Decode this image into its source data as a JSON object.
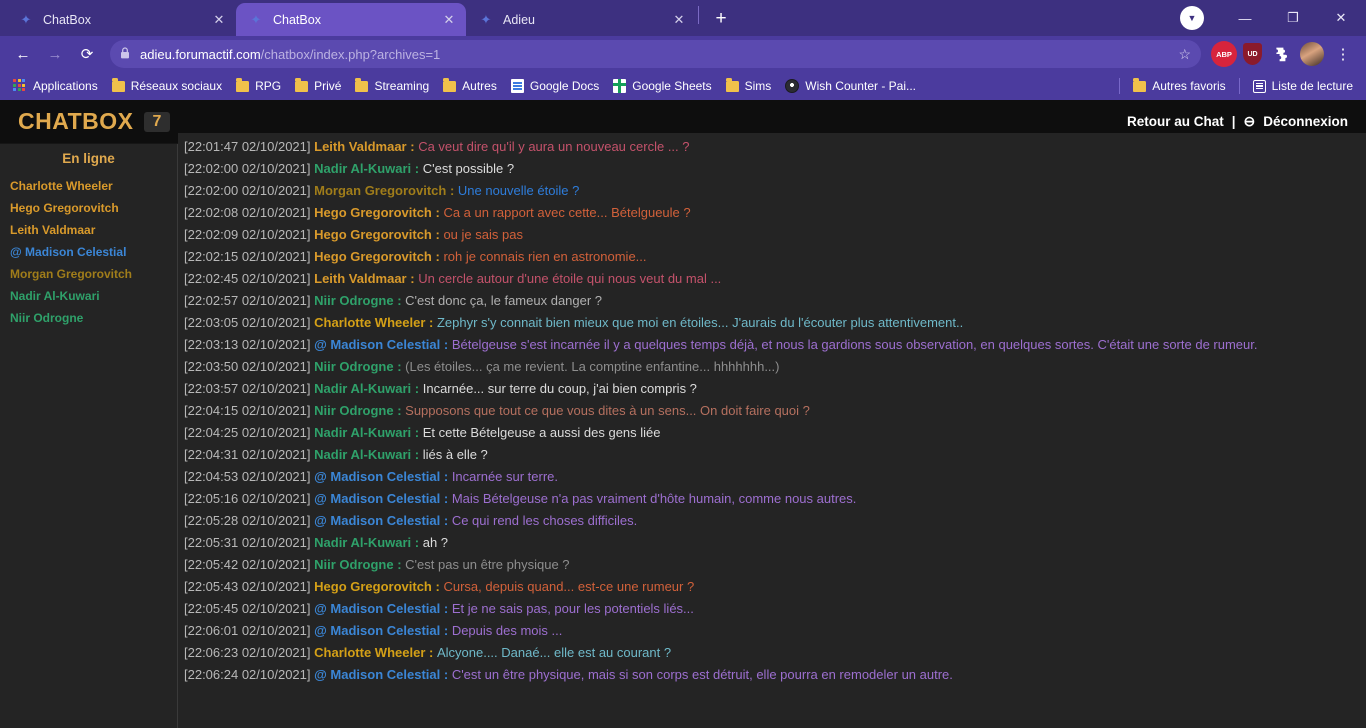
{
  "browser": {
    "tabs": [
      {
        "title": "ChatBox",
        "active": false,
        "favicon": "star-favicon"
      },
      {
        "title": "ChatBox",
        "active": true,
        "favicon": "star-favicon"
      },
      {
        "title": "Adieu",
        "active": false,
        "favicon": "star-favicon"
      }
    ],
    "new_tab_label": "+",
    "close_label": "✕",
    "window_controls": {
      "minimize": "—",
      "maximize": "❐",
      "close": "✕"
    },
    "profile_badge": "▼",
    "nav": {
      "back": "←",
      "forward": "→",
      "reload": "⟳"
    },
    "omnibox": {
      "lock": "🔒",
      "url_domain": "adieu.forumactif.com",
      "url_path": "/chatbox/index.php?archives=1",
      "star": "☆"
    },
    "extensions": [
      {
        "name": "adblock-plus-extension",
        "label": "ABP"
      },
      {
        "name": "ublock-extension",
        "label": "UD"
      },
      {
        "name": "puzzle-extension",
        "label": "❖"
      }
    ],
    "menu_label": "⋮",
    "bookmarks": [
      {
        "label": "Applications",
        "icon": "apps-grid-icon"
      },
      {
        "label": "Réseaux sociaux",
        "icon": "folder-icon"
      },
      {
        "label": "RPG",
        "icon": "folder-icon"
      },
      {
        "label": "Privé",
        "icon": "folder-icon"
      },
      {
        "label": "Streaming",
        "icon": "folder-icon"
      },
      {
        "label": "Autres",
        "icon": "folder-icon"
      },
      {
        "label": "Google Docs",
        "icon": "google-docs-icon"
      },
      {
        "label": "Google Sheets",
        "icon": "google-sheets-icon"
      },
      {
        "label": "Sims",
        "icon": "folder-icon"
      },
      {
        "label": "Wish Counter - Pai...",
        "icon": "wish-counter-icon"
      }
    ],
    "bookmarks_right": [
      {
        "label": "Autres favoris",
        "icon": "folder-icon"
      },
      {
        "label": "Liste de lecture",
        "icon": "reading-list-icon"
      }
    ]
  },
  "chatbox": {
    "title": "CHATBOX",
    "badge": "7",
    "back_to_chat": "Retour au Chat",
    "separator": "|",
    "logout_icon": "⊖",
    "logout": "Déconnexion",
    "online_title": "En ligne",
    "online_users": [
      {
        "name": "Charlotte Wheeler",
        "color": "#d99a2b"
      },
      {
        "name": "Hego Gregorovitch",
        "color": "#d99a2b"
      },
      {
        "name": "Leith Valdmaar",
        "color": "#d99a2b"
      },
      {
        "name": "@ Madison Celestial",
        "color": "#3b86d6"
      },
      {
        "name": "Morgan Gregorovitch",
        "color": "#a07d1a"
      },
      {
        "name": "Nadir Al-Kuwari",
        "color": "#2fa16a"
      },
      {
        "name": "Niir Odrogne",
        "color": "#2fa16a"
      }
    ],
    "messages": [
      {
        "time": "[22:01:47 02/10/2021]",
        "author": "Leith Valdmaar",
        "author_color": "#d99a2b",
        "text": "Ca veut dire qu'il y aura un nouveau cercle ... ?",
        "text_color": "#c4526b"
      },
      {
        "time": "[22:02:00 02/10/2021]",
        "author": "Nadir Al-Kuwari",
        "author_color": "#2fa16a",
        "text": "C'est possible ?",
        "text_color": "#dcdcdc"
      },
      {
        "time": "[22:02:00 02/10/2021]",
        "author": "Morgan Gregorovitch",
        "author_color": "#a07d1a",
        "text": "Une nouvelle étoile ?",
        "text_color": "#2e7ddb"
      },
      {
        "time": "[22:02:08 02/10/2021]",
        "author": "Hego Gregorovitch",
        "author_color": "#d99a2b",
        "text": "Ca a un rapport avec cette... Bételgueule ?",
        "text_color": "#d2613a"
      },
      {
        "time": "[22:02:09 02/10/2021]",
        "author": "Hego Gregorovitch",
        "author_color": "#d99a2b",
        "text": "ou je sais pas",
        "text_color": "#d2613a"
      },
      {
        "time": "[22:02:15 02/10/2021]",
        "author": "Hego Gregorovitch",
        "author_color": "#d99a2b",
        "text": "roh je connais rien en astronomie...",
        "text_color": "#d2613a"
      },
      {
        "time": "[22:02:45 02/10/2021]",
        "author": "Leith Valdmaar",
        "author_color": "#d99a2b",
        "text": "Un cercle autour d'une étoile qui nous veut du mal ...",
        "text_color": "#c4526b"
      },
      {
        "time": "[22:02:57 02/10/2021]",
        "author": "Niir Odrogne",
        "author_color": "#2fa16a",
        "text": "C'est donc ça, le fameux danger ?",
        "text_color": "#b0b0b0"
      },
      {
        "time": "[22:03:05 02/10/2021]",
        "author": "Charlotte Wheeler",
        "author_color": "#d4a017",
        "text": "Zephyr s'y connait bien mieux que moi en étoiles... J'aurais du l'écouter plus attentivement..",
        "text_color": "#6fb9c9"
      },
      {
        "time": "[22:03:13 02/10/2021]",
        "author": "@ Madison Celestial",
        "author_color": "#3b86d6",
        "text": "Bételgeuse s'est incarnée il y a quelques temps déjà, et nous la gardions sous observation, en quelques sortes. C'était une sorte de rumeur.",
        "text_color": "#9d6fd0"
      },
      {
        "time": "[22:03:50 02/10/2021]",
        "author": "Niir Odrogne",
        "author_color": "#2fa16a",
        "text": "(Les étoiles... ça me revient. La comptine enfantine... hhhhhhh...)",
        "text_color": "#8e8e8e"
      },
      {
        "time": "[22:03:57 02/10/2021]",
        "author": "Nadir Al-Kuwari",
        "author_color": "#2fa16a",
        "text": "Incarnée... sur terre du coup, j'ai bien compris ?",
        "text_color": "#dcdcdc"
      },
      {
        "time": "[22:04:15 02/10/2021]",
        "author": "Niir Odrogne",
        "author_color": "#2fa16a",
        "text": "Supposons que tout ce que vous dites à un sens... On doit faire quoi ?",
        "text_color": "#b5705f"
      },
      {
        "time": "[22:04:25 02/10/2021]",
        "author": "Nadir Al-Kuwari",
        "author_color": "#2fa16a",
        "text": "Et cette Bételgeuse a aussi des gens liée",
        "text_color": "#dcdcdc"
      },
      {
        "time": "[22:04:31 02/10/2021]",
        "author": "Nadir Al-Kuwari",
        "author_color": "#2fa16a",
        "text": "liés à elle ?",
        "text_color": "#dcdcdc"
      },
      {
        "time": "[22:04:53 02/10/2021]",
        "author": "@ Madison Celestial",
        "author_color": "#3b86d6",
        "text": "Incarnée sur terre.",
        "text_color": "#9d6fd0"
      },
      {
        "time": "[22:05:16 02/10/2021]",
        "author": "@ Madison Celestial",
        "author_color": "#3b86d6",
        "text": "Mais Bételgeuse n'a pas vraiment d'hôte humain, comme nous autres.",
        "text_color": "#9d6fd0"
      },
      {
        "time": "[22:05:28 02/10/2021]",
        "author": "@ Madison Celestial",
        "author_color": "#3b86d6",
        "text": "Ce qui rend les choses difficiles.",
        "text_color": "#9d6fd0"
      },
      {
        "time": "[22:05:31 02/10/2021]",
        "author": "Nadir Al-Kuwari",
        "author_color": "#2fa16a",
        "text": "ah ?",
        "text_color": "#dcdcdc"
      },
      {
        "time": "[22:05:42 02/10/2021]",
        "author": "Niir Odrogne",
        "author_color": "#2fa16a",
        "text": "C'est pas un être physique ?",
        "text_color": "#8e8e8e"
      },
      {
        "time": "[22:05:43 02/10/2021]",
        "author": "Hego Gregorovitch",
        "author_color": "#d4a017",
        "text": "Cursa, depuis quand... est-ce une rumeur ?",
        "text_color": "#d2613a"
      },
      {
        "time": "[22:05:45 02/10/2021]",
        "author": "@ Madison Celestial",
        "author_color": "#3b86d6",
        "text": "Et je ne sais pas, pour les potentiels liés...",
        "text_color": "#9d6fd0"
      },
      {
        "time": "[22:06:01 02/10/2021]",
        "author": "@ Madison Celestial",
        "author_color": "#3b86d6",
        "text": "Depuis des mois ...",
        "text_color": "#9d6fd0"
      },
      {
        "time": "[22:06:23 02/10/2021]",
        "author": "Charlotte Wheeler",
        "author_color": "#d4a017",
        "text": "Alcyone.... Danaé... elle est au courant ?",
        "text_color": "#6fb9c9"
      },
      {
        "time": "[22:06:24 02/10/2021]",
        "author": "@ Madison Celestial",
        "author_color": "#3b86d6",
        "text": "C'est un être physique, mais si son corps est détruit, elle pourra en remodeler un autre.",
        "text_color": "#9d6fd0"
      }
    ]
  }
}
